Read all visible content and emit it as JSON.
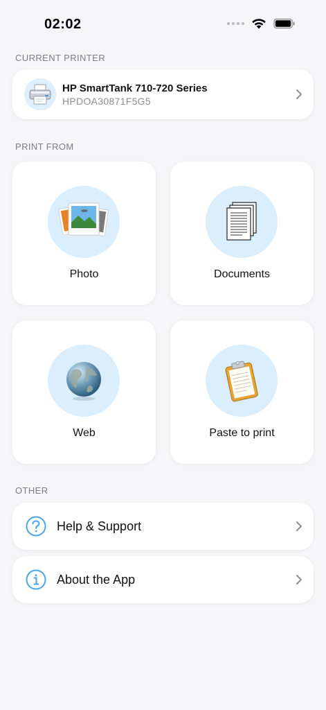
{
  "status_bar": {
    "time": "02:02"
  },
  "sections": {
    "current_printer": "CURRENT PRINTER",
    "print_from": "PRINT FROM",
    "other": "OTHER"
  },
  "printer": {
    "name": "HP SmartTank 710-720 Series",
    "id": "HPDOA30871F5G5"
  },
  "print_options": [
    {
      "label": "Photo",
      "icon": "photo-icon"
    },
    {
      "label": "Documents",
      "icon": "documents-icon"
    },
    {
      "label": "Web",
      "icon": "globe-icon"
    },
    {
      "label": "Paste to print",
      "icon": "clipboard-icon"
    }
  ],
  "other_items": [
    {
      "label": "Help & Support",
      "icon": "question-circle-icon"
    },
    {
      "label": "About the App",
      "icon": "info-circle-icon"
    }
  ],
  "colors": {
    "accent": "#4aa3e8",
    "circle_bg": "#dbeefd",
    "background": "#f6f6f8"
  }
}
